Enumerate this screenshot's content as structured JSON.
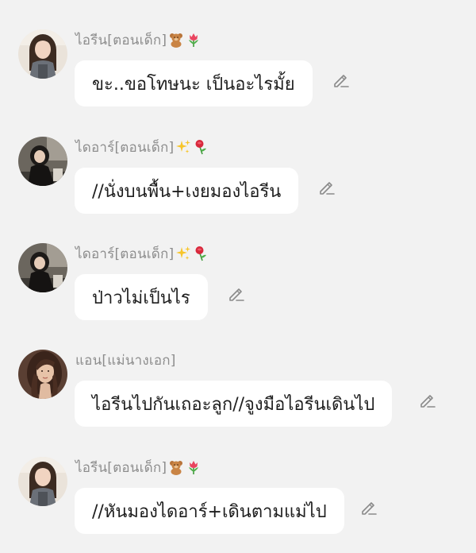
{
  "messages": [
    {
      "sender": "ไอรีน[ตอนเด็ก]",
      "emoji_icons": [
        "teddy-bear-icon",
        "tulip-icon"
      ],
      "text": "ขะ..ขอโทษนะ เป็นอะไรมั้ย",
      "avatar": "avatar-irene-child"
    },
    {
      "sender": "ไดอาร์[ตอนเด็ก]",
      "emoji_icons": [
        "sparkles-icon",
        "rose-icon"
      ],
      "text": "//นั่งบนพื้น+เงยมองไอรีน",
      "avatar": "avatar-diar-child"
    },
    {
      "sender": "ไดอาร์[ตอนเด็ก]",
      "emoji_icons": [
        "sparkles-icon",
        "rose-icon"
      ],
      "text": "ป่าวไม่เป็นไร",
      "avatar": "avatar-diar-child"
    },
    {
      "sender": "แอน[แม่นางเอก]",
      "emoji_icons": [],
      "text": "ไอรีนไปกันเถอะลูก//จูงมือไอรีนเดินไป",
      "avatar": "avatar-ann-mother"
    },
    {
      "sender": "ไอรีน[ตอนเด็ก]",
      "emoji_icons": [
        "teddy-bear-icon",
        "tulip-icon"
      ],
      "text": "//หันมองไดอาร์+เดินตามแม่ไป",
      "avatar": "avatar-irene-child"
    }
  ],
  "colors": {
    "background": "#f2f2f2",
    "bubble": "#ffffff",
    "name_text": "#8d8d8d",
    "message_text": "#1e1e1e",
    "edit_icon": "#8a8a8a"
  }
}
